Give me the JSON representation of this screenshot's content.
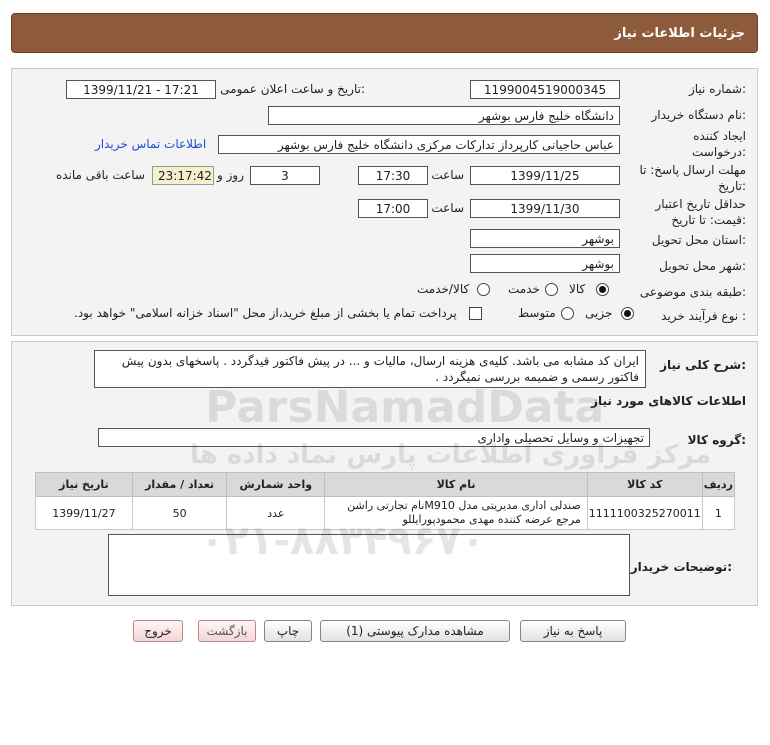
{
  "header": {
    "title": "جزئیات اطلاعات نیاز"
  },
  "info": {
    "need_number_label": "شماره نیاز:",
    "need_number": "1199004519000345",
    "announce_label": "تاریخ و ساعت اعلان عمومی:",
    "announce_value": "1399/11/21 - 17:21",
    "buyer_org_label": "نام دستگاه خریدار:",
    "buyer_org": "دانشگاه خلیج فارس بوشهر",
    "creator_label": "ایجاد کننده درخواست:",
    "creator": "عباس حاجیانی کارپرداز تدارکات مرکزی دانشگاه خلیج فارس بوشهر",
    "contact_link": "اطلاعات تماس خریدار",
    "reply_deadline_label": "مهلت ارسال پاسخ: تا تاریخ:",
    "reply_date": "1399/11/25",
    "time_label": "ساعت",
    "reply_time": "17:30",
    "days_value": "3",
    "days_label": "روز و",
    "remaining_time": "23:17:42",
    "remaining_label": "ساعت باقی مانده",
    "validity_label": "حداقل تاریخ اعتبار قیمت: تا تاریخ:",
    "validity_date": "1399/11/30",
    "validity_time": "17:00",
    "province_label": "استان محل تحویل:",
    "province": "بوشهر",
    "city_label": "شهر محل تحویل:",
    "city": "بوشهر",
    "category_label": "طبقه بندی موضوعی:",
    "category_options": [
      "کالا",
      "خدمت",
      "کالا/خدمت"
    ],
    "process_label": "نوع فرآیند خرید :",
    "process_options": [
      "جزیی",
      "متوسط"
    ],
    "payment_note": "پرداخت تمام یا بخشی از مبلغ خرید،از محل \"اسناد خزانه اسلامی\" خواهد بود."
  },
  "description": {
    "label": "شرح کلی نیاز:",
    "text": "ایران کد مشابه می باشد. کلیه‌ی هزینه ارسال، مالیات و ... در پیش فاکتور قیدگردد . پاسخهای بدون پیش فاکتور رسمی و ضمیمه بررسی نمیگردد ."
  },
  "goods": {
    "section_title": "اطلاعات کالاهای مورد نیاز",
    "group_label": "گروه کالا:",
    "group_value": "تجهیزات و وسایل تحصیلی واداری",
    "columns": [
      "ردیف",
      "کد کالا",
      "نام کالا",
      "واحد شمارش",
      "تعداد / مقدار",
      "تاریخ نیاز"
    ],
    "rows": [
      {
        "row": "1",
        "code": "1111100325270011",
        "name": "صندلی اداری مدیریتی مدل M910نام تجارتی راشن مرجع عرضه کننده مهدی محمودپورایللو",
        "unit": "عدد",
        "qty": "50",
        "date": "1399/11/27"
      }
    ]
  },
  "buyer_notes": {
    "label": "توضیحات خریدار:",
    "value": ""
  },
  "buttons": {
    "reply": "پاسخ به نیاز",
    "docs": "مشاهده مدارک پیوستی (1)",
    "print": "چاپ",
    "back": "بازگشت",
    "exit": "خروج"
  },
  "watermark": {
    "brand": "ParsNamadData",
    "tagline": "مرکز فراوری اطلاعات پارس نماد داده ها",
    "phone": "۰۲۱-۸۸۳۴۹۶۷۰"
  }
}
